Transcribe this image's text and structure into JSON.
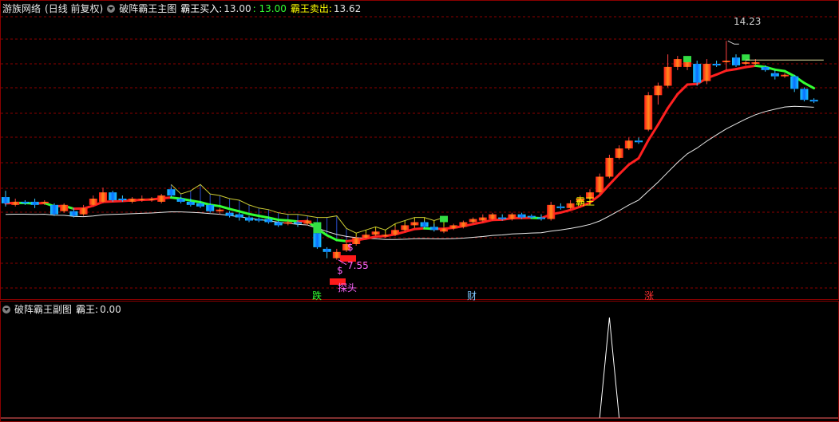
{
  "header": {
    "app_name": "游族网络",
    "period_label": "(日线 前复权)",
    "indicator_title": "破阵霸王主图",
    "buy_label": "霸王买入:",
    "buy_value": "13.00",
    "buy_value2": ": 13.00",
    "sell_label": "霸王卖出:",
    "sell_value": "13.62"
  },
  "sub_header": {
    "indicator_title": "破阵霸王副图",
    "value_label": "霸王:",
    "value": "0.00"
  },
  "annotations": {
    "high_label": "14.23",
    "low_label": "7.55",
    "signal_label": "霸王",
    "dollar_1": "$",
    "dollar_2": "$",
    "bottom_label": "探头",
    "marker_down": "跌",
    "marker_money": "财",
    "marker_up": "涨"
  },
  "colors": {
    "up": "#ff2020",
    "down": "#00b4ff",
    "up_line": "#ff2020",
    "down_line": "#33ff33",
    "grid": "#8b0000",
    "white_line": "#e8e8e8",
    "fill_blue": "#2a4ecc",
    "fill_yellow": "#d8d800",
    "marker_down": "#33ff33",
    "marker_money": "#7fc8ff",
    "marker_up": "#ff3030"
  },
  "chart_data": {
    "type": "candlestick",
    "ylim": [
      6.3,
      15.0
    ],
    "grid": "dashed-horizontal",
    "candles": [
      {
        "o": 9.25,
        "c": 9.05,
        "h": 9.45,
        "l": 8.95
      },
      {
        "o": 9.0,
        "c": 9.1,
        "h": 9.2,
        "l": 8.95
      },
      {
        "o": 9.1,
        "c": 9.05,
        "h": 9.15,
        "l": 9.0
      },
      {
        "o": 9.1,
        "c": 9.0,
        "h": 9.2,
        "l": 8.9
      },
      {
        "o": 9.05,
        "c": 9.1,
        "h": 9.15,
        "l": 9.0
      },
      {
        "o": 9.0,
        "c": 8.7,
        "h": 9.05,
        "l": 8.65
      },
      {
        "o": 8.8,
        "c": 9.0,
        "h": 9.05,
        "l": 8.75
      },
      {
        "o": 8.8,
        "c": 8.65,
        "h": 8.9,
        "l": 8.6
      },
      {
        "o": 8.7,
        "c": 8.9,
        "h": 9.0,
        "l": 8.65
      },
      {
        "o": 9.0,
        "c": 9.2,
        "h": 9.3,
        "l": 8.95
      },
      {
        "o": 9.1,
        "c": 9.4,
        "h": 9.55,
        "l": 9.05
      },
      {
        "o": 9.4,
        "c": 9.15,
        "h": 9.45,
        "l": 9.1
      },
      {
        "o": 9.2,
        "c": 9.15,
        "h": 9.3,
        "l": 9.1
      },
      {
        "o": 9.1,
        "c": 9.2,
        "h": 9.25,
        "l": 9.05
      },
      {
        "o": 9.15,
        "c": 9.2,
        "h": 9.3,
        "l": 9.1
      },
      {
        "o": 9.15,
        "c": 9.2,
        "h": 9.25,
        "l": 9.1
      },
      {
        "o": 9.1,
        "c": 9.3,
        "h": 9.35,
        "l": 9.05
      },
      {
        "o": 9.5,
        "c": 9.3,
        "h": 9.55,
        "l": 9.25
      },
      {
        "o": 9.2,
        "c": 9.1,
        "h": 9.25,
        "l": 9.05
      },
      {
        "o": 9.1,
        "c": 9.0,
        "h": 9.2,
        "l": 8.95
      },
      {
        "o": 9.05,
        "c": 8.95,
        "h": 9.1,
        "l": 8.9
      },
      {
        "o": 9.0,
        "c": 8.8,
        "h": 9.05,
        "l": 8.75
      },
      {
        "o": 8.8,
        "c": 8.85,
        "h": 8.9,
        "l": 8.7
      },
      {
        "o": 8.75,
        "c": 8.65,
        "h": 8.8,
        "l": 8.6
      },
      {
        "o": 8.7,
        "c": 8.6,
        "h": 8.75,
        "l": 8.5
      },
      {
        "o": 8.6,
        "c": 8.5,
        "h": 8.65,
        "l": 8.45
      },
      {
        "o": 8.55,
        "c": 8.5,
        "h": 8.6,
        "l": 8.45
      },
      {
        "o": 8.55,
        "c": 8.45,
        "h": 8.6,
        "l": 8.4
      },
      {
        "o": 8.45,
        "c": 8.35,
        "h": 8.5,
        "l": 8.3
      },
      {
        "o": 8.4,
        "c": 8.45,
        "h": 8.5,
        "l": 8.35
      },
      {
        "o": 8.45,
        "c": 8.4,
        "h": 8.5,
        "l": 8.3
      },
      {
        "o": 8.4,
        "c": 8.5,
        "h": 8.55,
        "l": 8.35
      },
      {
        "o": 8.1,
        "c": 7.65,
        "h": 8.15,
        "l": 7.6
      },
      {
        "o": 7.6,
        "c": 7.5,
        "h": 7.65,
        "l": 7.3
      },
      {
        "o": 7.3,
        "c": 7.5,
        "h": 7.6,
        "l": 7.25
      },
      {
        "o": 7.55,
        "c": 7.75,
        "h": 7.8,
        "l": 7.5
      },
      {
        "o": 7.75,
        "c": 7.95,
        "h": 8.0,
        "l": 7.7
      },
      {
        "o": 7.95,
        "c": 8.05,
        "h": 8.1,
        "l": 7.9
      },
      {
        "o": 8.05,
        "c": 8.15,
        "h": 8.2,
        "l": 8.0
      },
      {
        "o": 8.0,
        "c": 8.05,
        "h": 8.1,
        "l": 7.95
      },
      {
        "o": 8.05,
        "c": 8.2,
        "h": 8.3,
        "l": 8.0
      },
      {
        "o": 8.2,
        "c": 8.35,
        "h": 8.4,
        "l": 8.15
      },
      {
        "o": 8.35,
        "c": 8.45,
        "h": 8.5,
        "l": 8.3
      },
      {
        "o": 8.45,
        "c": 8.3,
        "h": 8.5,
        "l": 8.25
      },
      {
        "o": 8.3,
        "c": 8.2,
        "h": 8.4,
        "l": 8.15
      },
      {
        "o": 8.15,
        "c": 8.25,
        "h": 8.3,
        "l": 8.1
      },
      {
        "o": 8.25,
        "c": 8.35,
        "h": 8.4,
        "l": 8.2
      },
      {
        "o": 8.3,
        "c": 8.45,
        "h": 8.5,
        "l": 8.25
      },
      {
        "o": 8.45,
        "c": 8.55,
        "h": 8.6,
        "l": 8.4
      },
      {
        "o": 8.5,
        "c": 8.6,
        "h": 8.7,
        "l": 8.45
      },
      {
        "o": 8.55,
        "c": 8.7,
        "h": 8.75,
        "l": 8.5
      },
      {
        "o": 8.6,
        "c": 8.55,
        "h": 8.7,
        "l": 8.5
      },
      {
        "o": 8.55,
        "c": 8.7,
        "h": 8.75,
        "l": 8.5
      },
      {
        "o": 8.7,
        "c": 8.6,
        "h": 8.75,
        "l": 8.55
      },
      {
        "o": 8.65,
        "c": 8.6,
        "h": 8.7,
        "l": 8.55
      },
      {
        "o": 8.6,
        "c": 8.55,
        "h": 8.7,
        "l": 8.5
      },
      {
        "o": 8.55,
        "c": 9.0,
        "h": 9.1,
        "l": 8.5
      },
      {
        "o": 8.95,
        "c": 8.9,
        "h": 9.05,
        "l": 8.85
      },
      {
        "o": 8.9,
        "c": 9.05,
        "h": 9.15,
        "l": 8.85
      },
      {
        "o": 9.1,
        "c": 9.2,
        "h": 9.3,
        "l": 9.05
      },
      {
        "o": 9.2,
        "c": 9.4,
        "h": 9.5,
        "l": 9.15
      },
      {
        "o": 9.4,
        "c": 9.9,
        "h": 10.0,
        "l": 9.35
      },
      {
        "o": 9.9,
        "c": 10.5,
        "h": 10.6,
        "l": 9.85
      },
      {
        "o": 10.5,
        "c": 10.8,
        "h": 10.9,
        "l": 10.45
      },
      {
        "o": 10.8,
        "c": 11.05,
        "h": 11.15,
        "l": 10.75
      },
      {
        "o": 11.05,
        "c": 11.0,
        "h": 11.15,
        "l": 10.95
      },
      {
        "o": 11.4,
        "c": 12.5,
        "h": 12.6,
        "l": 11.35
      },
      {
        "o": 12.5,
        "c": 12.8,
        "h": 12.9,
        "l": 12.2
      },
      {
        "o": 12.8,
        "c": 13.4,
        "h": 13.8,
        "l": 12.75
      },
      {
        "o": 13.4,
        "c": 13.65,
        "h": 13.75,
        "l": 13.3
      },
      {
        "o": 13.4,
        "c": 13.6,
        "h": 13.7,
        "l": 13.3
      },
      {
        "o": 13.5,
        "c": 12.9,
        "h": 13.6,
        "l": 12.8
      },
      {
        "o": 12.95,
        "c": 13.5,
        "h": 13.65,
        "l": 12.85
      },
      {
        "o": 13.5,
        "c": 13.45,
        "h": 13.6,
        "l": 13.4
      },
      {
        "o": 13.6,
        "c": 13.6,
        "h": 14.23,
        "l": 13.3
      },
      {
        "o": 13.7,
        "c": 13.45,
        "h": 13.8,
        "l": 13.4
      },
      {
        "o": 13.5,
        "c": 13.55,
        "h": 13.6,
        "l": 13.45
      },
      {
        "o": 13.5,
        "c": 13.55,
        "h": 13.65,
        "l": 13.45
      },
      {
        "o": 13.4,
        "c": 13.3,
        "h": 13.45,
        "l": 13.25
      },
      {
        "o": 13.2,
        "c": 13.1,
        "h": 13.3,
        "l": 13.0
      },
      {
        "o": 13.1,
        "c": 13.15,
        "h": 13.2,
        "l": 13.05
      },
      {
        "o": 13.1,
        "c": 12.7,
        "h": 13.15,
        "l": 12.6
      },
      {
        "o": 12.7,
        "c": 12.35,
        "h": 12.75,
        "l": 12.3
      },
      {
        "o": 12.35,
        "c": 12.3,
        "h": 12.4,
        "l": 12.25
      }
    ],
    "sub_series": {
      "name": "霸王",
      "ylim": [
        0,
        1
      ],
      "values": [
        0,
        0,
        0,
        0,
        0,
        0,
        0,
        0,
        0,
        0,
        0,
        0,
        0,
        0,
        0,
        0,
        0,
        0,
        0,
        0,
        0,
        0,
        0,
        0,
        0,
        0,
        0,
        0,
        0,
        0,
        0,
        0,
        0,
        0,
        0,
        0,
        0,
        0,
        0,
        0,
        0,
        0,
        0,
        0,
        0,
        0,
        0,
        0,
        0,
        0,
        0,
        0,
        0,
        0,
        0,
        0,
        0,
        0,
        0,
        0,
        0,
        0,
        1,
        0,
        0,
        0,
        0,
        0,
        0,
        0,
        0,
        0,
        0,
        0,
        0,
        0,
        0,
        0,
        0,
        0,
        0,
        0,
        0,
        0,
        0,
        0
      ]
    }
  }
}
